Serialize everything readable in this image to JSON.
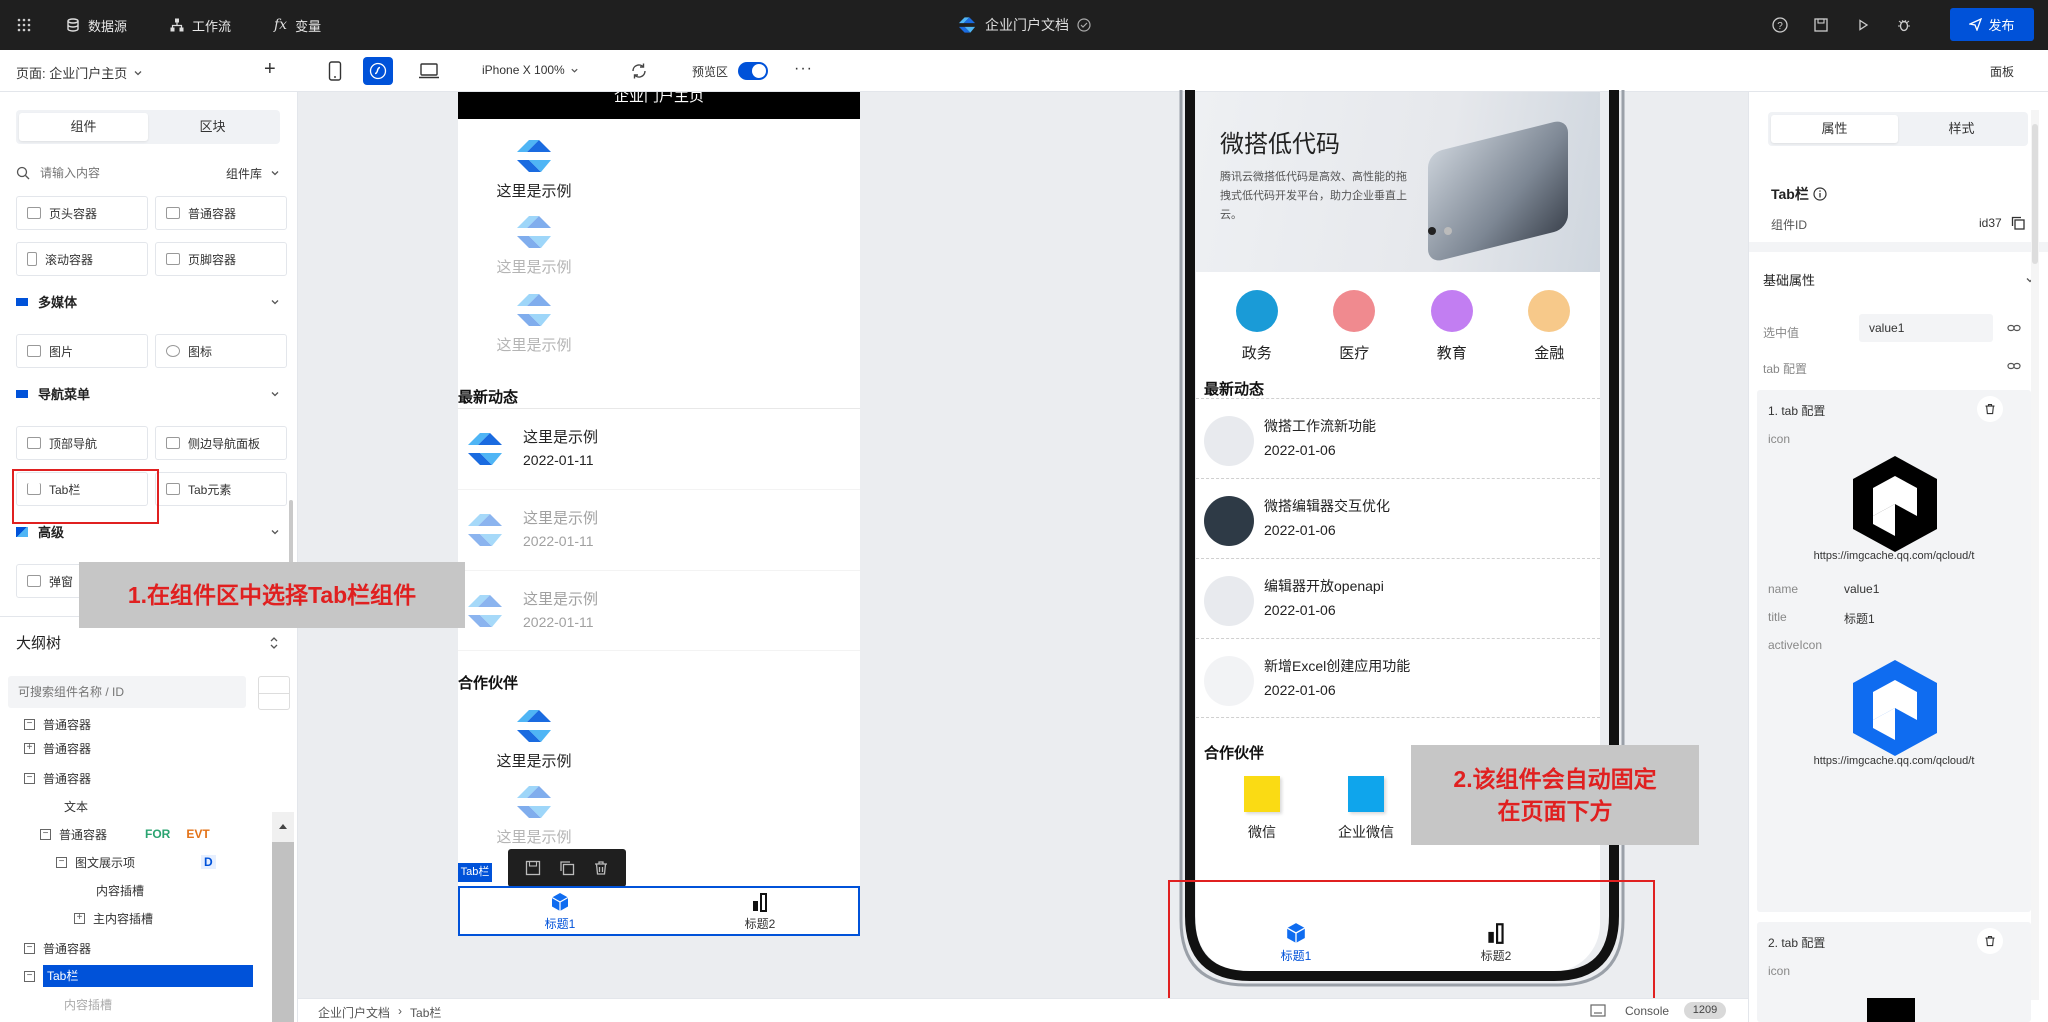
{
  "topbar": {
    "nav": [
      "数据源",
      "工作流",
      "变量"
    ],
    "title": "企业门户文档",
    "publish_label": "发布"
  },
  "toolbar": {
    "page_label": "页面: 企业门户主页",
    "device": "iPhone X 100%",
    "preview_label": "预览区",
    "panel_label": "面板"
  },
  "left": {
    "tabs": [
      "组件",
      "区块"
    ],
    "search_placeholder": "请输入内容",
    "library_label": "组件库",
    "row1": [
      "页头容器",
      "普通容器"
    ],
    "row2": [
      "滚动容器",
      "页脚容器"
    ],
    "group_media": "多媒体",
    "row3": [
      "图片",
      "图标"
    ],
    "group_nav": "导航菜单",
    "row4": [
      "顶部导航",
      "侧边导航面板"
    ],
    "row5": [
      "Tab栏",
      "Tab元素"
    ],
    "group_adv": "高级",
    "row6": [
      "弹窗"
    ],
    "outline_title": "大纲树",
    "outline_search_placeholder": "可搜索组件名称 / ID",
    "tree": {
      "n1": "普通容器",
      "n2": "普通容器",
      "n3": "普通容器",
      "n4": "文本",
      "n5": "普通容器",
      "n5_for": "FOR",
      "n5_evt": "EVT",
      "n6": "图文展示项",
      "n6_d": "D",
      "n7": "内容插槽",
      "n8": "主内容插槽",
      "n9": "普通容器",
      "n10": "Tab栏",
      "n11": "内容插槽"
    }
  },
  "canvas": {
    "header_text": "企业门户主页",
    "example": "这里是示例",
    "section_news": "最新动态",
    "date": "2022-01-11",
    "section_partners": "合作伙伴",
    "tab_badge": "Tab栏",
    "tab1": "标题1",
    "tab2": "标题2"
  },
  "phone": {
    "banner_title": "微搭低代码",
    "banner_desc": "腾讯云微搭低代码是高效、高性能的拖拽式低代码开发平台，助力企业垂直上云。",
    "categories": [
      {
        "label": "政务",
        "color": "#1a9bd7"
      },
      {
        "label": "医疗",
        "color": "#f08a8f"
      },
      {
        "label": "教育",
        "color": "#c27ef2"
      },
      {
        "label": "金融",
        "color": "#f7c98a"
      }
    ],
    "section_news": "最新动态",
    "news": [
      {
        "title": "微搭工作流新功能",
        "date": "2022-01-06"
      },
      {
        "title": "微搭编辑器交互优化",
        "date": "2022-01-06"
      },
      {
        "title": "编辑器开放openapi",
        "date": "2022-01-06"
      },
      {
        "title": "新增Excel创建应用功能",
        "date": "2022-01-06"
      }
    ],
    "section_partners": "合作伙伴",
    "partners": [
      {
        "label": "微信",
        "color": "#fadb14"
      },
      {
        "label": "企业微信",
        "color": "#0fa5ec"
      }
    ],
    "tab1": "标题1",
    "tab2": "标题2"
  },
  "annotations": {
    "a1": "1.在组件区中选择Tab栏组件",
    "a2_line1": "2.该组件会自动固定",
    "a2_line2": "在页面下方"
  },
  "right": {
    "tabs": [
      "属性",
      "样式"
    ],
    "component_title": "Tab栏",
    "id_label": "组件ID",
    "id_value": "id37",
    "section_basic": "基础属性",
    "selected_label": "选中值",
    "selected_value": "value1",
    "tab_config_label": "tab 配置",
    "cfg1_title": "1. tab 配置",
    "icon_label": "icon",
    "url": "https://imgcache.qq.com/qcloud/t",
    "name_label": "name",
    "name_value": "value1",
    "title_label": "title",
    "title_value": "标题1",
    "active_icon_label": "activeIcon",
    "cfg2_title": "2. tab 配置"
  },
  "bottom": {
    "crumb1": "企业门户文档",
    "crumb2": "Tab栏",
    "console_label": "Console",
    "console_count": "1209"
  }
}
